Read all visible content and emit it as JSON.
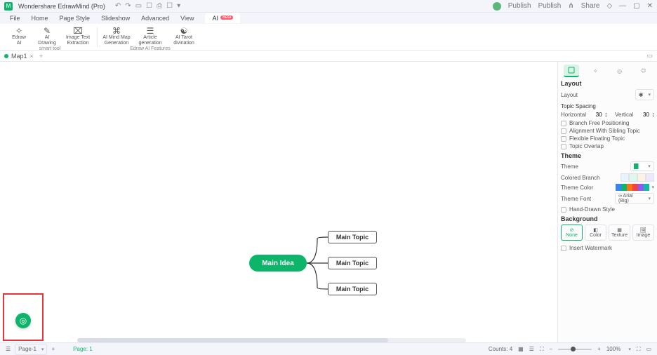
{
  "titlebar": {
    "app_title": "Wondershare EdrawMind (Pro)",
    "publish": "Publish",
    "share": "Share"
  },
  "menu": {
    "file": "File",
    "home": "Home",
    "pagestyle": "Page Style",
    "slideshow": "Slideshow",
    "advanced": "Advanced",
    "view": "View",
    "ai": "AI",
    "ai_badge": "Beta"
  },
  "ribbon": {
    "items": [
      {
        "label_top": "Edraw",
        "label_bot": "AI"
      },
      {
        "label_top": "AI",
        "label_bot": "Drawing"
      },
      {
        "label_top": "Image Text",
        "label_bot": "Extraction"
      },
      {
        "label_top": "AI Mind Map",
        "label_bot": "Generation"
      },
      {
        "label_top": "Article",
        "label_bot": "generation"
      },
      {
        "label_top": "AI Tarot",
        "label_bot": "divination"
      }
    ],
    "caption1": "smart tool",
    "caption2": "Edraw AI Features"
  },
  "doctab": {
    "name": "Map1"
  },
  "mindmap": {
    "root": "Main Idea",
    "topics": [
      "Main Topic",
      "Main Topic",
      "Main Topic"
    ]
  },
  "panel": {
    "layout_h": "Layout",
    "layout_l": "Layout",
    "spacing_h": "Topic Spacing",
    "horiz": "Horizontal",
    "horiz_v": "30",
    "vert": "Vertical",
    "vert_v": "30",
    "opt1": "Branch Free Positioning",
    "opt2": "Alignment With Sibling Topic",
    "opt3": "Flexible Floating Topic",
    "opt4": "Topic Overlap",
    "theme_h": "Theme",
    "theme_l": "Theme",
    "colbranch": "Colored Branch",
    "themecolor": "Theme Color",
    "themefont": "Theme Font",
    "font_val": "∞ Arial (Big)",
    "handdrawn": "Hand-Drawn Style",
    "bg_h": "Background",
    "bg_none": "None",
    "bg_color": "Color",
    "bg_texture": "Texture",
    "bg_image": "Image",
    "watermark": "Insert Watermark"
  },
  "status": {
    "page_btn": "Page-1",
    "page_label": "Page: 1",
    "counts": "Counts: 4",
    "zoom": "100%"
  }
}
